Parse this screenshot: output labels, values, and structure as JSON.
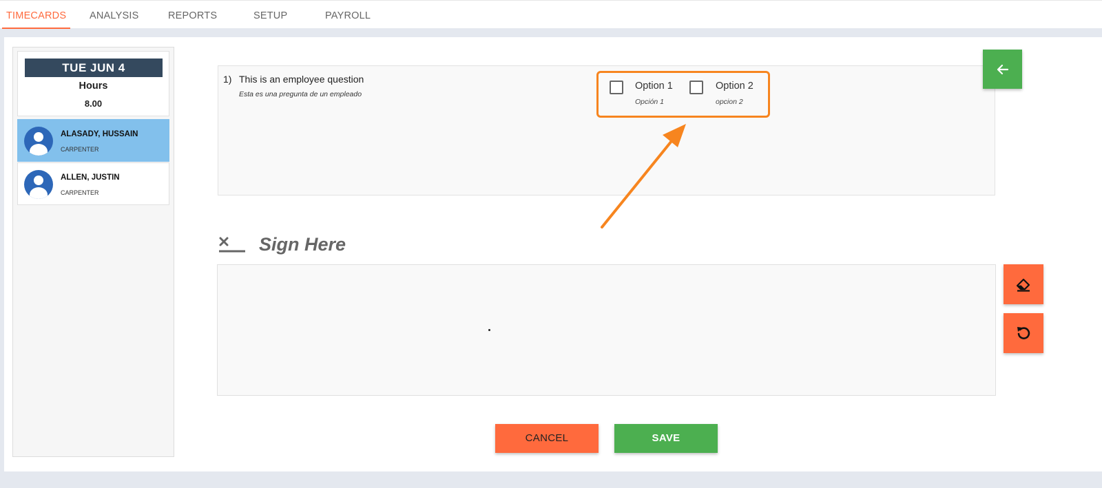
{
  "nav": {
    "tabs": [
      {
        "label": "TIMECARDS",
        "active": true
      },
      {
        "label": "ANALYSIS",
        "active": false
      },
      {
        "label": "REPORTS",
        "active": false
      },
      {
        "label": "SETUP",
        "active": false
      },
      {
        "label": "PAYROLL",
        "active": false
      }
    ]
  },
  "sidebar": {
    "date": "TUE JUN 4",
    "hours_label": "Hours",
    "hours_value": "8.00",
    "employees": [
      {
        "name": "ALASADY, HUSSAIN",
        "role": "CARPENTER",
        "selected": true
      },
      {
        "name": "ALLEN, JUSTIN",
        "role": "CARPENTER",
        "selected": false
      }
    ]
  },
  "question": {
    "number": "1)",
    "text": "This is an employee question",
    "subtext": "Esta es una pregunta de un empleado",
    "options": [
      {
        "label": "Option 1",
        "sublabel": "Opción 1",
        "checked": false
      },
      {
        "label": "Option 2",
        "sublabel": "opcion 2",
        "checked": false
      }
    ]
  },
  "signature": {
    "label": "Sign Here"
  },
  "actions": {
    "cancel_label": "CANCEL",
    "save_label": "SAVE"
  },
  "colors": {
    "accent": "#ff6a3d",
    "green": "#4caf50",
    "highlight": "#f7851f",
    "selected_row": "#82c0ec",
    "date_banner": "#34495e"
  },
  "icons": {
    "back": "arrow-left-icon",
    "eraser": "eraser-icon",
    "undo": "undo-icon",
    "sign": "sign-x-icon"
  }
}
